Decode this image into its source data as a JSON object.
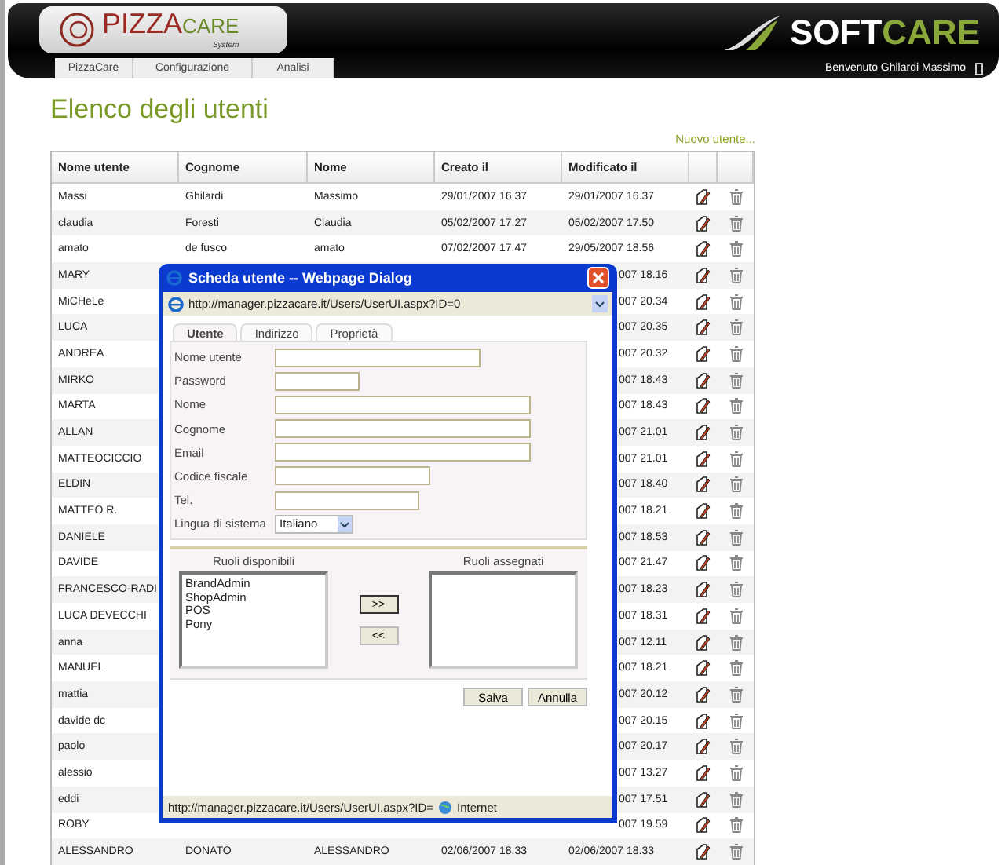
{
  "header": {
    "logo": {
      "word1": "PIZZA",
      "word2": "CARE",
      "sub": "System"
    },
    "brand": {
      "word1": "SOFT",
      "word2": "CARE"
    },
    "nav": [
      {
        "label": "PizzaCare"
      },
      {
        "label": "Configurazione"
      },
      {
        "label": "Analisi"
      }
    ],
    "welcome": "Benvenuto Ghilardi Massimo"
  },
  "title": "Elenco degli utenti",
  "new_link": "Nuovo utente...",
  "table": {
    "columns": [
      "Nome utente",
      "Cognome",
      "Nome",
      "Creato il",
      "Modificato il"
    ],
    "rows": [
      {
        "user": "Massi",
        "surname": "Ghilardi",
        "name": "Massimo",
        "created": "29/01/2007 16.37",
        "modified": "29/01/2007 16.37"
      },
      {
        "user": "claudia",
        "surname": "Foresti",
        "name": "Claudia",
        "created": "05/02/2007 17.27",
        "modified": "05/02/2007 17.50"
      },
      {
        "user": "amato",
        "surname": "de fusco",
        "name": "amato",
        "created": "07/02/2007 17.47",
        "modified": "29/05/2007 18.56"
      },
      {
        "user": "MARY",
        "modified": "007 18.16"
      },
      {
        "user": "MiCHeLe",
        "modified": "007 20.34"
      },
      {
        "user": "LUCA",
        "modified": "007 20.35"
      },
      {
        "user": "ANDREA",
        "modified": "007 20.32"
      },
      {
        "user": "MIRKO",
        "modified": "007 18.43"
      },
      {
        "user": "MARTA",
        "modified": "007 18.43"
      },
      {
        "user": "ALLAN",
        "modified": "007 21.01"
      },
      {
        "user": "MATTEOCICCIO",
        "modified": "007 21.01"
      },
      {
        "user": "ELDIN",
        "modified": "007 18.40"
      },
      {
        "user": "MATTEO R.",
        "modified": "007 18.21"
      },
      {
        "user": "DANIELE",
        "modified": "007 18.53"
      },
      {
        "user": "DAVIDE",
        "modified": "007 21.47"
      },
      {
        "user": "FRANCESCO-RADI",
        "modified": "007 18.23"
      },
      {
        "user": "LUCA DEVECCHI",
        "modified": "007 18.31"
      },
      {
        "user": "anna",
        "modified": "007 12.11"
      },
      {
        "user": "MANUEL",
        "modified": "007 18.21"
      },
      {
        "user": "mattia",
        "modified": "007 20.12"
      },
      {
        "user": "davide dc",
        "modified": "007 20.15"
      },
      {
        "user": "paolo",
        "modified": "007 20.17"
      },
      {
        "user": "alessio",
        "modified": "007 13.27"
      },
      {
        "user": "eddi",
        "modified": "007 17.51"
      },
      {
        "user": "ROBY",
        "modified": "007 19.59"
      },
      {
        "user": "ALESSANDRO",
        "surname": "DONATO",
        "name": "ALESSANDRO",
        "created": "02/06/2007 18.33",
        "modified": "02/06/2007 18.33"
      }
    ]
  },
  "dialog": {
    "title": "Scheda utente -- Webpage Dialog",
    "address": "http://manager.pizzacare.it/Users/UserUI.aspx?ID=0",
    "tabs": [
      {
        "label": "Utente",
        "selected": true
      },
      {
        "label": "Indirizzo",
        "selected": false
      },
      {
        "label": "Proprietà",
        "selected": false
      }
    ],
    "fields": [
      {
        "label": "Nome utente",
        "kind": "text"
      },
      {
        "label": "Password",
        "kind": "text"
      },
      {
        "label": "Nome",
        "kind": "text"
      },
      {
        "label": "Cognome",
        "kind": "text"
      },
      {
        "label": "Email",
        "kind": "text"
      },
      {
        "label": "Codice fiscale",
        "kind": "text"
      },
      {
        "label": "Tel.",
        "kind": "text"
      },
      {
        "label": "Lingua di sistema",
        "kind": "select",
        "value": "Italiano"
      }
    ],
    "available_label": "Ruoli disponibili",
    "assigned_label": "Ruoli assegnati",
    "available": [
      "BrandAdmin",
      "ShopAdmin",
      "POS",
      "Pony"
    ],
    "add_button": ">>",
    "remove_button": "<<",
    "buttons": [
      "Salva",
      "Annulla"
    ],
    "status": {
      "url": "http://manager.pizzacare.it/Users/UserUI.aspx?ID=",
      "zone": "Internet"
    }
  }
}
